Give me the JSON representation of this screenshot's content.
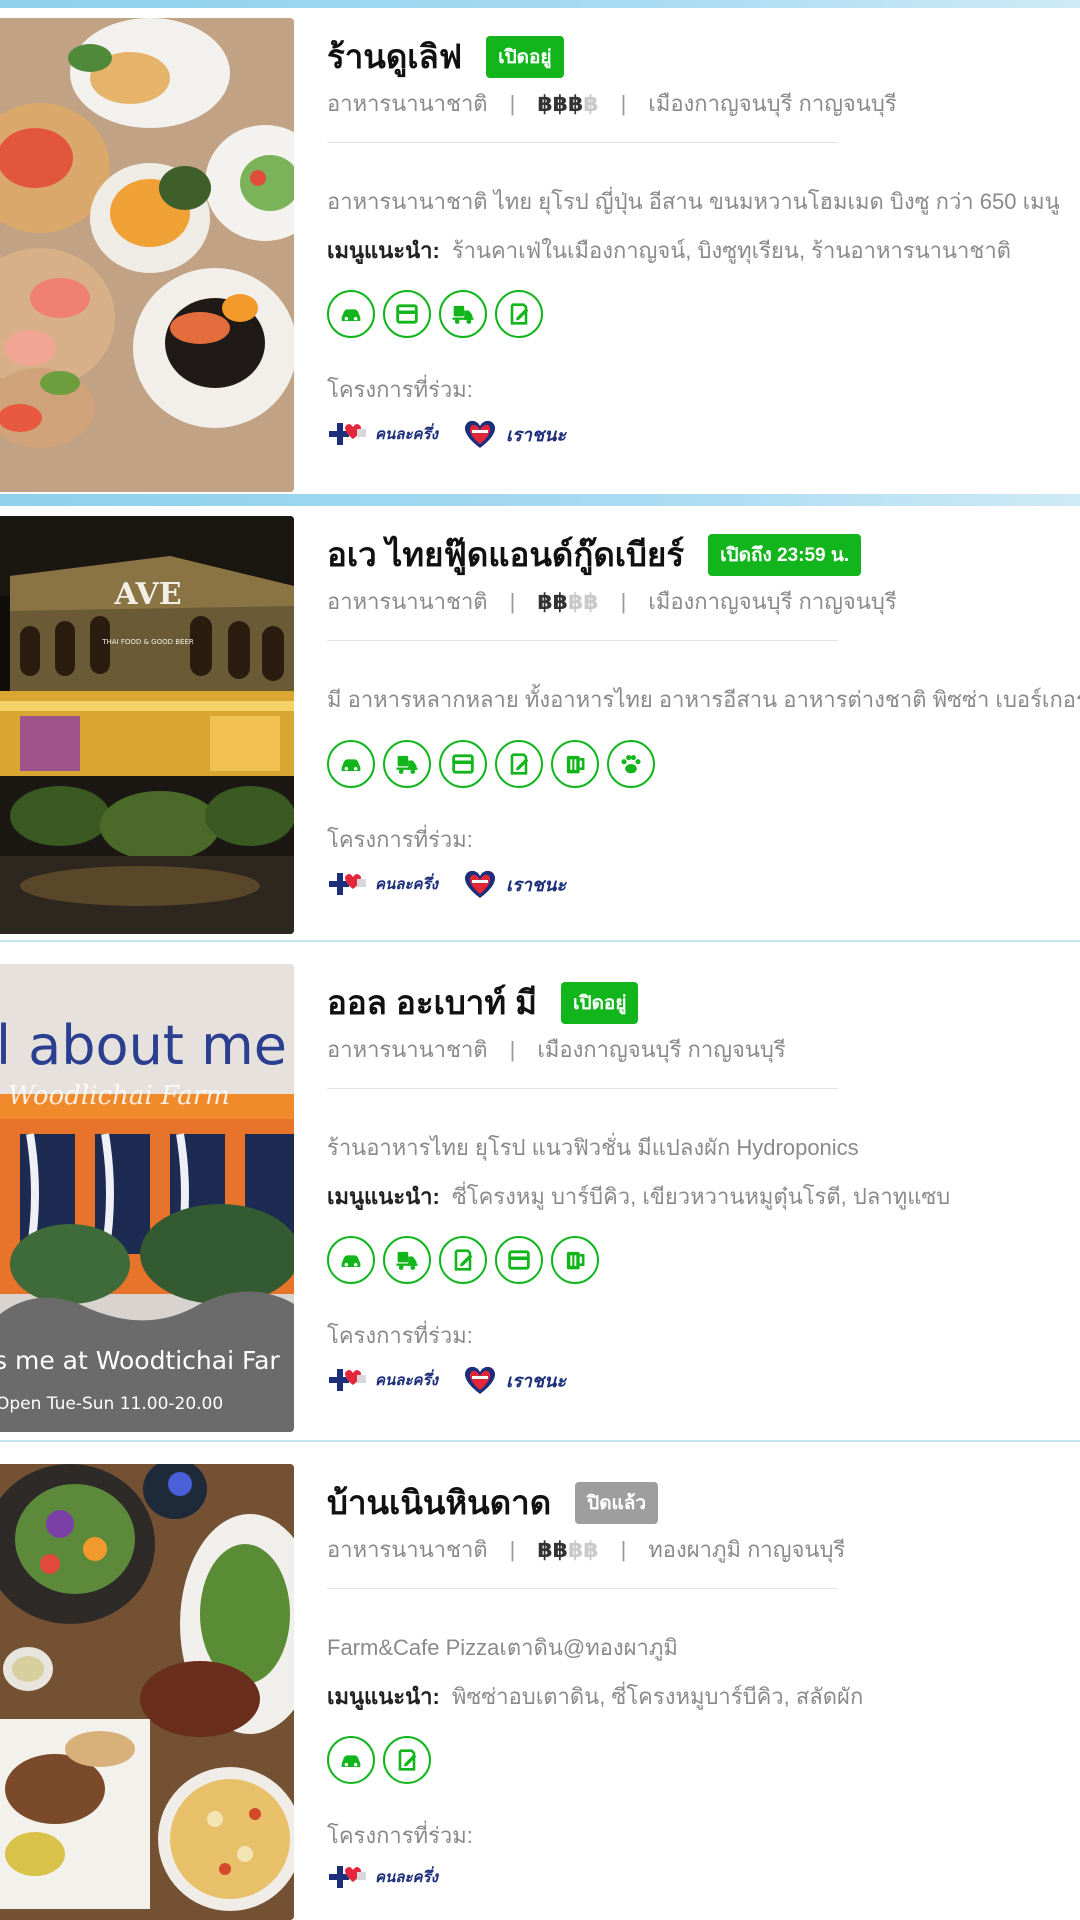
{
  "common": {
    "recommended_label": "เมนูแนะนำ:",
    "projects_label": "โครงการที่ร่วม:",
    "meta_separator": "|",
    "project_names": {
      "khonlakhrueng": "คนละครึ่ง",
      "raochana": "เราชนะ"
    }
  },
  "restaurants": [
    {
      "name": "ร้านดูเลิฟ",
      "status": "เปิดอยู่",
      "category": "อาหารนานาชาติ",
      "price_on": "฿฿฿",
      "price_off": "฿",
      "location": "เมืองกาญจนบุรี กาญจนบุรี",
      "description": "อาหารนานาชาติ ไทย ยุโรป ญี่ปุ่น อีสาน ขนมหวานโฮมเมด บิงซู กว่า 650 เมนู",
      "recommended": "ร้านคาเฟ่ในเมืองกาญจน์, บิงซูทุเรียน, ร้านอาหารนานาชาติ",
      "service_icons": [
        "car-parking-icon",
        "card-payment-icon",
        "delivery-icon",
        "reservation-icon"
      ],
      "projects": [
        "khonlakhrueng",
        "raochana"
      ]
    },
    {
      "name": "อเว ไทยฟู๊ดแอนด์กู๊ดเบียร์",
      "status": "เปิดถึง 23:59 น.",
      "category": "อาหารนานาชาติ",
      "price_on": "฿฿",
      "price_off": "฿฿",
      "location": "เมืองกาญจนบุรี กาญจนบุรี",
      "description": "มี อาหารหลากหลาย ทั้งอาหารไทย อาหารอีสาน อาหารต่างชาติ พิซซ่า เบอร์เกอร์ ฯลฯ",
      "photo_sign": "AVE",
      "photo_sign_sub": "THAI FOOD & GOOD BEER",
      "service_icons": [
        "car-parking-icon",
        "delivery-icon",
        "card-payment-icon",
        "reservation-icon",
        "beer-icon",
        "pet-friendly-icon"
      ],
      "projects": [
        "khonlakhrueng",
        "raochana"
      ]
    },
    {
      "name": "ออล อะเบาท์ มี",
      "status": "เปิดอยู่",
      "category": "อาหารนานาชาติ",
      "location": "เมืองกาญจนบุรี กาญจนบุรี",
      "description": "ร้านอาหารไทย ยุโรป แนวฟิวชั่น มีแปลงผัก Hydroponics",
      "recommended": "ซี่โครงหมู บาร์บีคิว, เขียวหวานหมูตุ๋นโรตี, ปลาทูแซบ",
      "photo_sign": "l about me",
      "photo_sign_sub": "Woodlichai Farm",
      "photo_banner": "s me at Woodtichai Far",
      "photo_hours": "Open Tue-Sun 11.00-20.00",
      "service_icons": [
        "car-parking-icon",
        "delivery-icon",
        "reservation-icon",
        "card-payment-icon",
        "beer-icon"
      ],
      "projects": [
        "khonlakhrueng",
        "raochana"
      ]
    },
    {
      "name": "บ้านเนินหินดาด",
      "status": "ปิดแล้ว",
      "category": "อาหารนานาชาติ",
      "price_on": "฿฿",
      "price_off": "฿฿",
      "location": "ทองผาภูมิ กาญจนบุรี",
      "description": "Farm&Cafe Pizzaเตาดิน@ทองผาภูมิ",
      "recommended": "พิซซ่าอบเตาดิน, ซี่โครงหมูบาร์บีคิว, สลัดผัก",
      "service_icons": [
        "car-parking-icon",
        "reservation-icon"
      ],
      "projects": [
        "khonlakhrueng"
      ]
    }
  ],
  "colors": {
    "accent_green": "#12b51c",
    "closed_gray": "#9e9e9e",
    "project_text": "#1d2f7a",
    "separator_blue": "#8fd0ec"
  }
}
